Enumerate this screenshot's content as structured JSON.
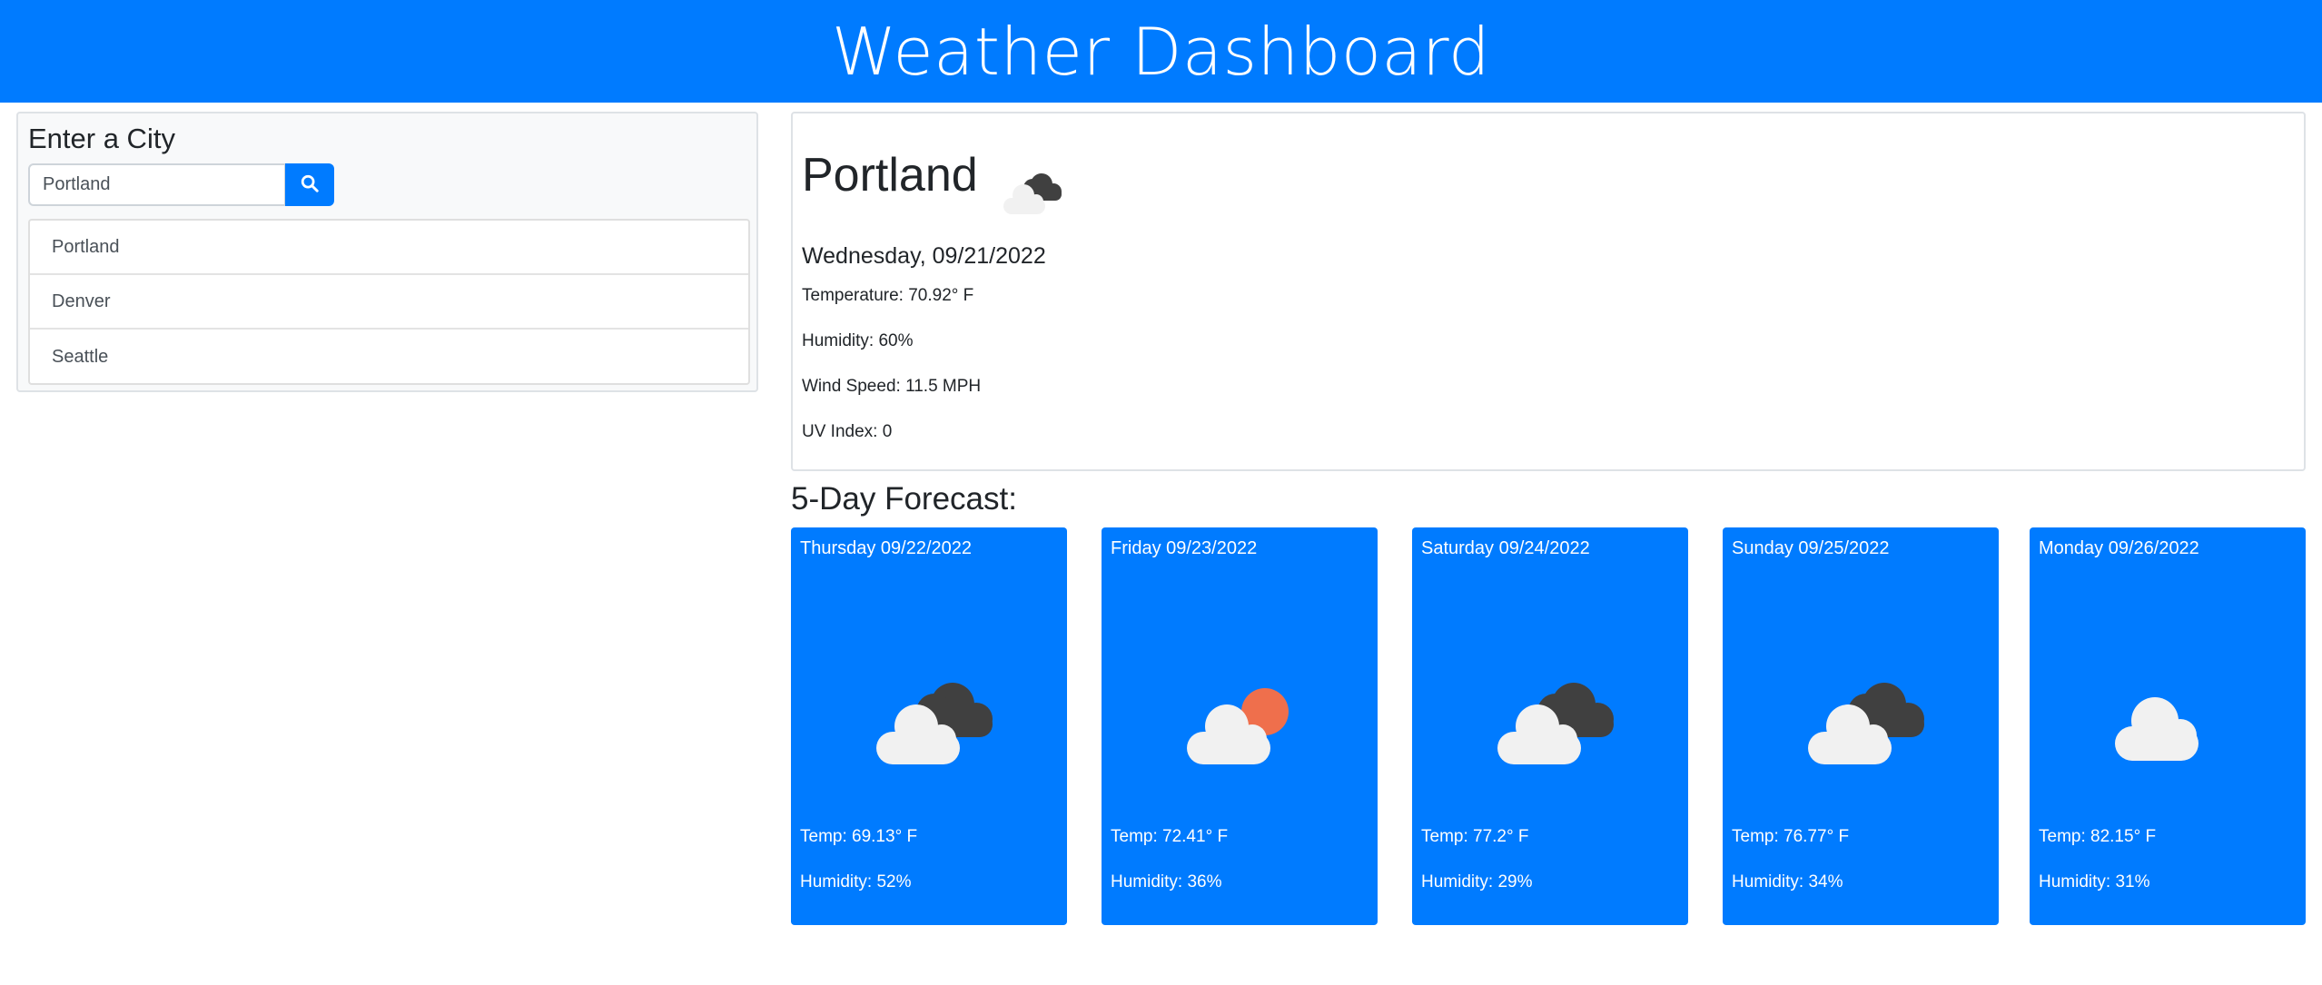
{
  "header": {
    "title": "Weather Dashboard"
  },
  "search": {
    "title": "Enter a City",
    "input_value": "Portland",
    "button_icon": "search-icon",
    "history": [
      "Portland",
      "Denver",
      "Seattle"
    ]
  },
  "current": {
    "city": "Portland",
    "icon": "broken-clouds-icon",
    "date": "Wednesday, 09/21/2022",
    "temperature": "Temperature: 70.92° F",
    "humidity": "Humidity: 60%",
    "wind": "Wind Speed: 11.5 MPH",
    "uv": "UV Index: 0"
  },
  "forecast": {
    "title": "5-Day Forecast:",
    "days": [
      {
        "date": "Thursday 09/22/2022",
        "icon": "broken-clouds-icon",
        "temp": "Temp: 69.13° F",
        "humidity": "Humidity: 52%"
      },
      {
        "date": "Friday 09/23/2022",
        "icon": "few-clouds-icon",
        "temp": "Temp: 72.41° F",
        "humidity": "Humidity: 36%"
      },
      {
        "date": "Saturday 09/24/2022",
        "icon": "broken-clouds-icon",
        "temp": "Temp: 77.2° F",
        "humidity": "Humidity: 29%"
      },
      {
        "date": "Sunday 09/25/2022",
        "icon": "broken-clouds-icon",
        "temp": "Temp: 76.77° F",
        "humidity": "Humidity: 34%"
      },
      {
        "date": "Monday 09/26/2022",
        "icon": "cloud-icon",
        "temp": "Temp: 82.15° F",
        "humidity": "Humidity: 31%"
      }
    ]
  },
  "colors": {
    "primary": "#007bff",
    "panel_bg": "#f8f9fa",
    "cloud_light": "#f1f1f1",
    "cloud_dark": "#404040",
    "sun": "#ef6f4c"
  }
}
